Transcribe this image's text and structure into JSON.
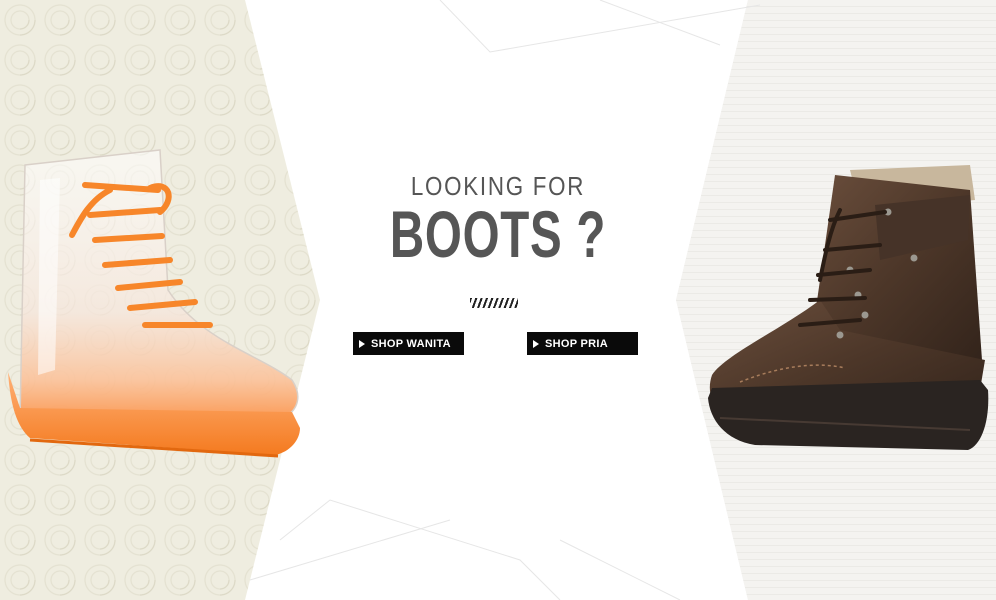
{
  "banner": {
    "headline_small": "LOOKING FOR",
    "headline_big": "BOOTS ?",
    "buttons": {
      "wanita_label": "SHOP WANITA",
      "pria_label": "SHOP PRIA"
    },
    "icons": {
      "button_arrow": "play-arrow-icon",
      "left_image": "clear-orange-rain-boot",
      "right_image": "brown-leather-work-boot"
    },
    "colors": {
      "button_bg": "#0a0a0a",
      "button_text": "#ffffff",
      "headline": "#565656",
      "left_panel": "#efede0",
      "right_panel": "#f1f0ed",
      "lace_orange": "#f7862a",
      "leather_brown": "#4a3629"
    }
  }
}
